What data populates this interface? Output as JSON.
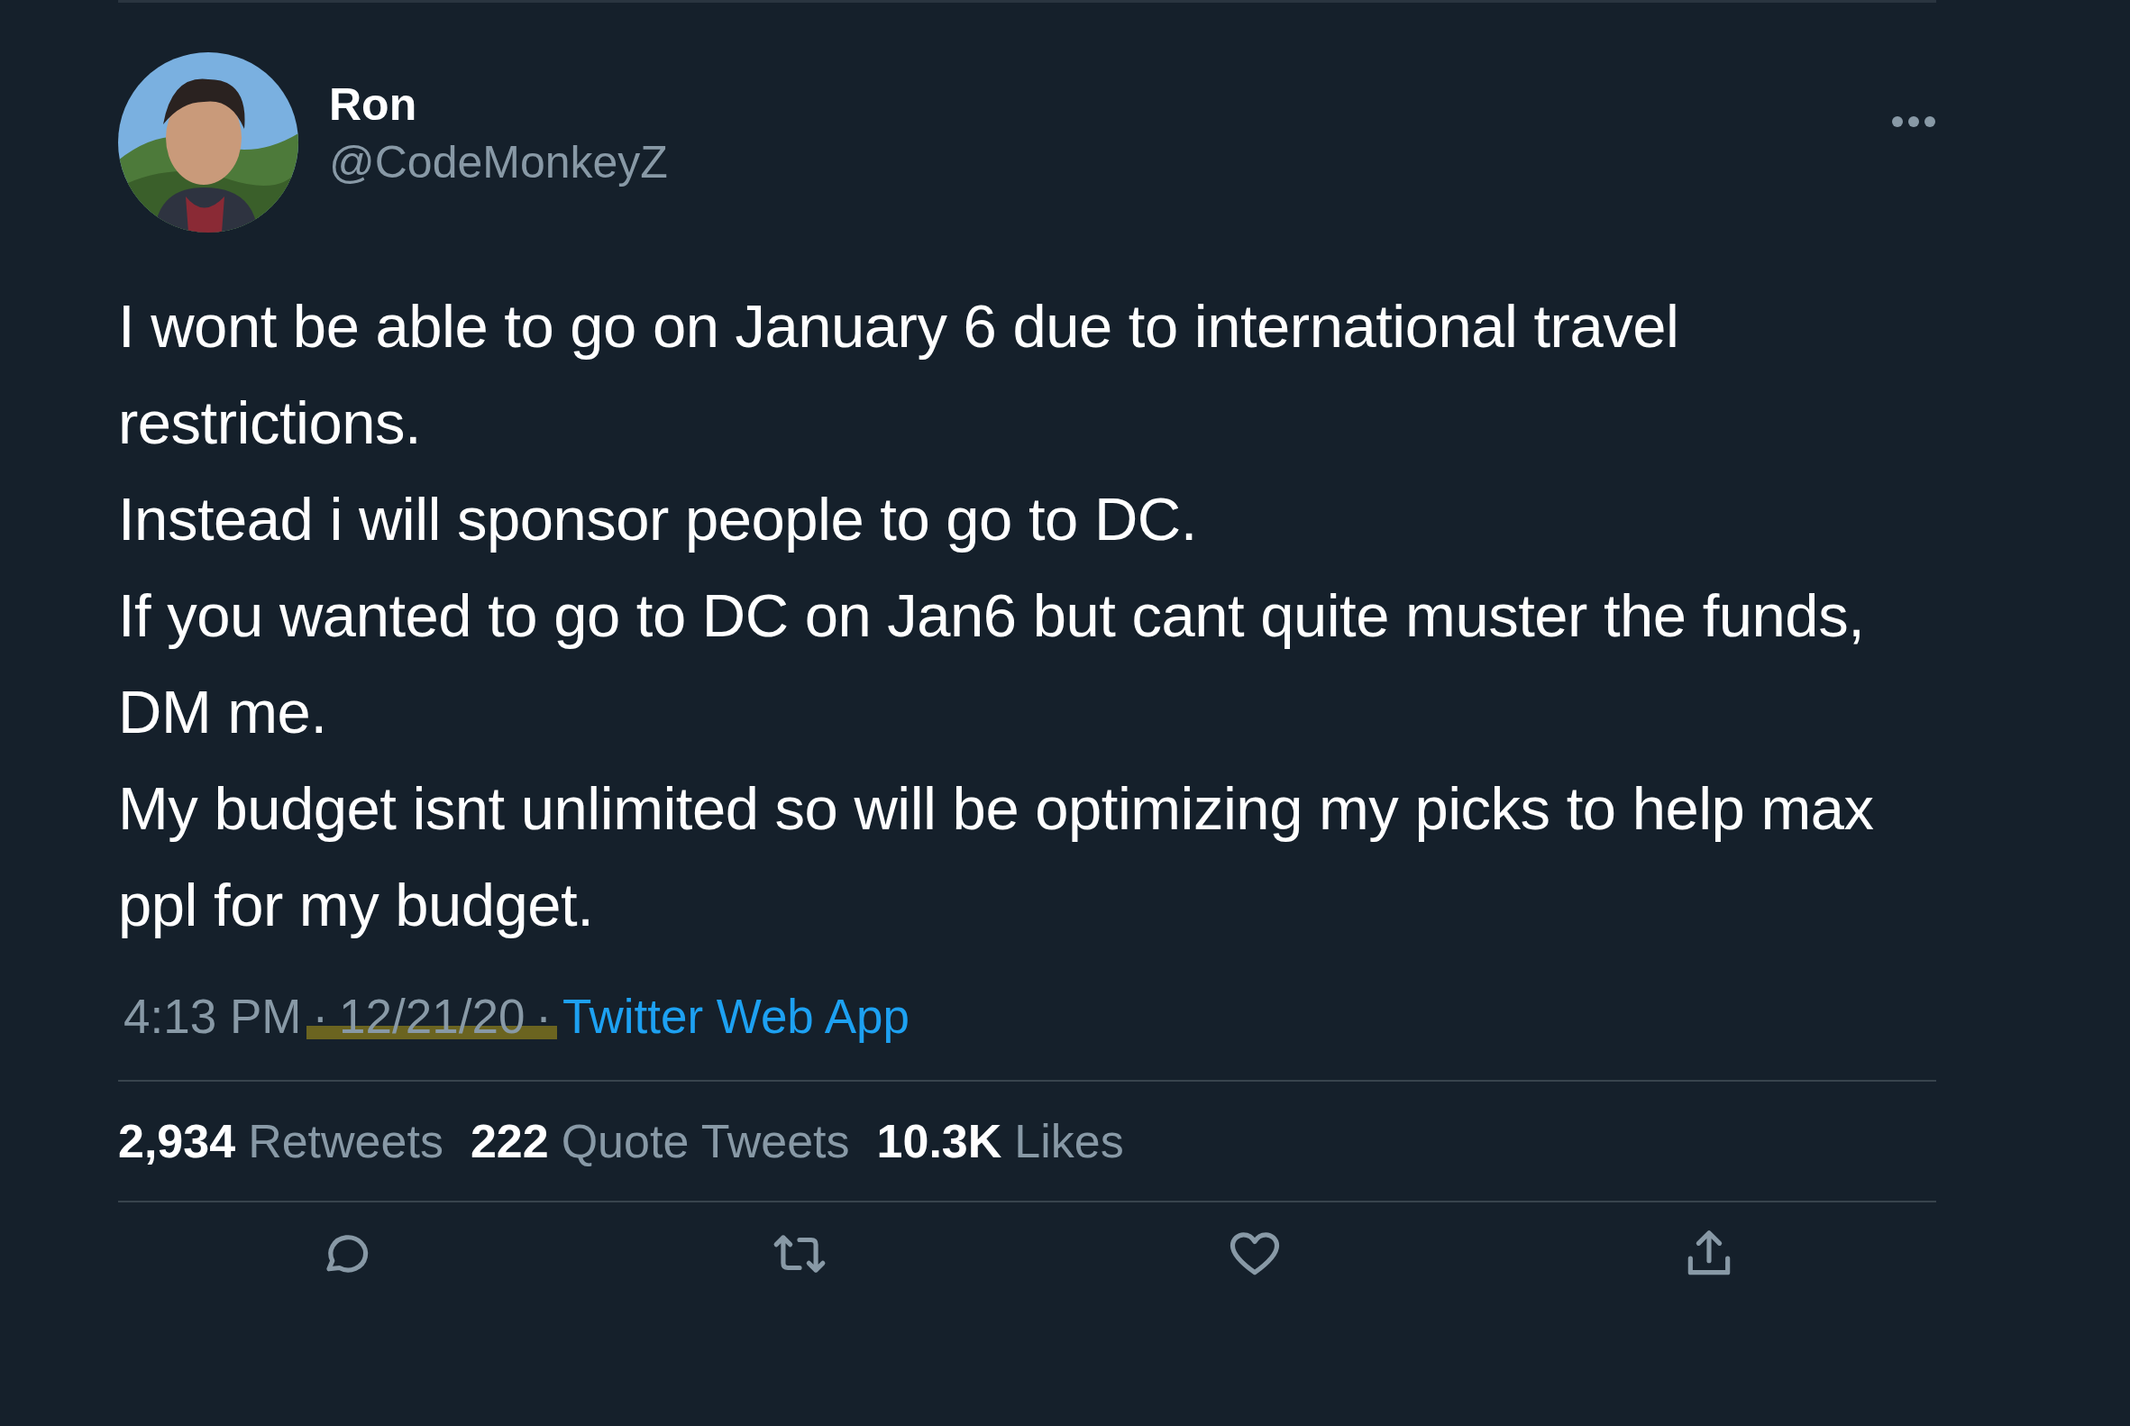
{
  "author": {
    "name": "Ron",
    "handle": "@CodeMonkeyZ"
  },
  "text": [
    "I wont be able to go on January 6 due to international travel restrictions.",
    "Instead i will sponsor people to go to DC.",
    "If you wanted to go to DC on Jan6 but cant quite muster the funds, DM me.",
    "My budget isnt unlimited so will be optimizing my picks to help max ppl for my budget."
  ],
  "meta": [
    {
      "kind": "text",
      "text": "4:13 PM",
      "highlighted": false
    },
    {
      "kind": "text",
      "text": "·",
      "highlighted": true
    },
    {
      "kind": "text",
      "text": "12/21/20",
      "highlighted": true
    },
    {
      "kind": "text",
      "text": "·",
      "highlighted": true
    },
    {
      "kind": "link",
      "text": "Twitter Web App",
      "highlighted": false
    }
  ],
  "stats": [
    {
      "count": "2,934",
      "label": "Retweets"
    },
    {
      "count": "222",
      "label": "Quote Tweets"
    },
    {
      "count": "10.3K",
      "label": "Likes"
    }
  ]
}
